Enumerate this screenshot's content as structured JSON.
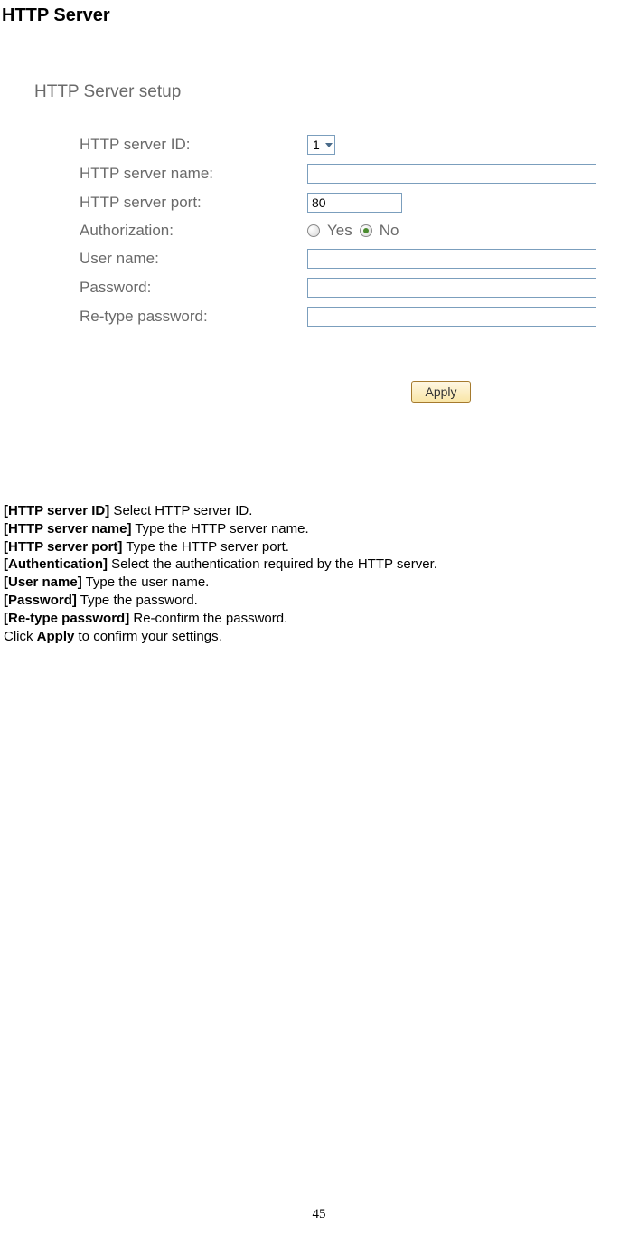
{
  "page": {
    "title": "HTTP Server",
    "number": "45"
  },
  "form": {
    "header": "HTTP Server setup",
    "rows": {
      "id_label": "HTTP server ID:",
      "id_value": "1",
      "name_label": "HTTP server name:",
      "name_value": "",
      "port_label": "HTTP server port:",
      "port_value": "80",
      "auth_label": "Authorization:",
      "auth_yes": "Yes",
      "auth_no": "No",
      "user_label": "User name:",
      "user_value": "",
      "pass_label": "Password:",
      "pass_value": "",
      "retype_label": "Re-type password:",
      "retype_value": ""
    },
    "apply": "Apply"
  },
  "desc": {
    "items": [
      {
        "term": "[HTTP server ID]",
        "text": " Select HTTP server ID."
      },
      {
        "term": "[HTTP server name]",
        "text": " Type the HTTP server name."
      },
      {
        "term": "[HTTP server port]",
        "text": " Type the HTTP server port."
      },
      {
        "term": "[Authentication]",
        "text": " Select the authentication required by the HTTP server."
      },
      {
        "term": "[User name]",
        "text": " Type the user name."
      },
      {
        "term": "[Password]",
        "text": " Type the password."
      },
      {
        "term": "[Re-type password]",
        "text": " Re-confirm the password."
      }
    ],
    "click_prefix": "Click ",
    "click_bold": "Apply",
    "click_suffix": " to confirm your settings."
  }
}
